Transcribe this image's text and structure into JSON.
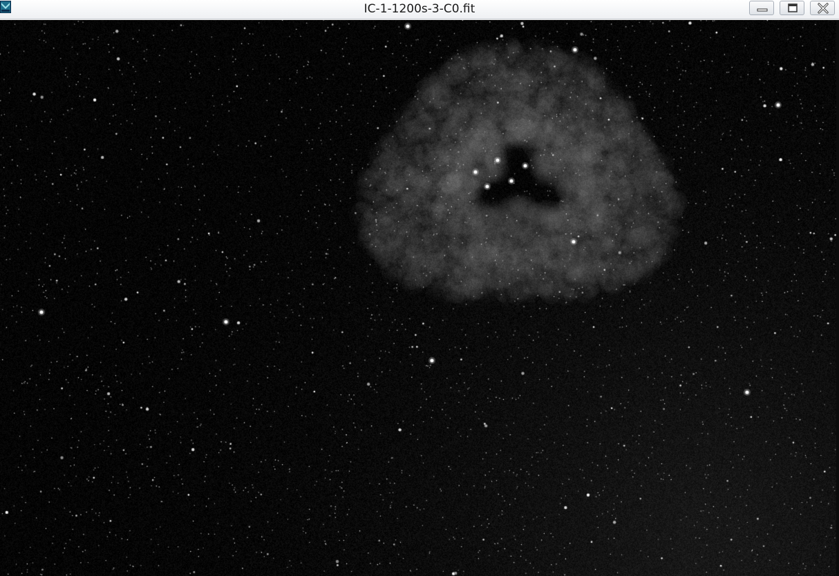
{
  "window": {
    "title": "IC-1-1200s-3-C0.fit",
    "app_icon": "fits-viewer-app-icon",
    "controls": {
      "minimize_icon": "minimize-icon",
      "maximize_icon": "maximize-icon",
      "close_icon": "close-icon"
    }
  },
  "image": {
    "subject_icon": "nebula-starfield-image",
    "background_color": "#040404",
    "nebula_color": "#8a8a8a",
    "star_color": "#ffffff"
  }
}
